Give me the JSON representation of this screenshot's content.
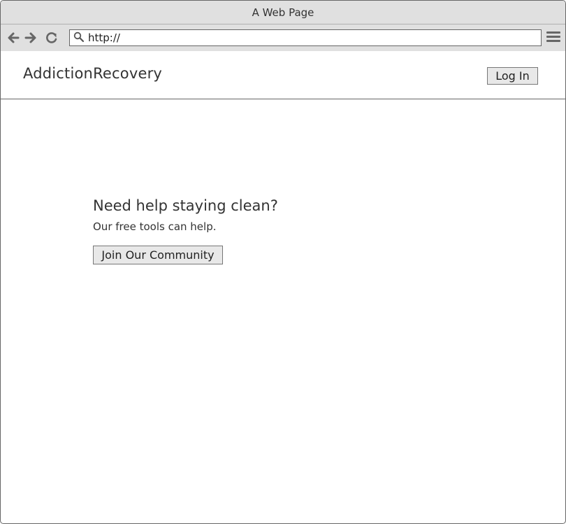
{
  "browser": {
    "title": "A Web Page",
    "url": "http://",
    "icons": {
      "back": "arrow-left-icon",
      "forward": "arrow-right-icon",
      "reload": "refresh-icon",
      "search": "search-icon",
      "menu": "hamburger-menu-icon"
    }
  },
  "site": {
    "brand": "AddictionRecovery",
    "login_label": "Log In"
  },
  "hero": {
    "heading": "Need help staying clean?",
    "subheading": "Our free tools can help.",
    "cta_label": "Join Our Community"
  }
}
